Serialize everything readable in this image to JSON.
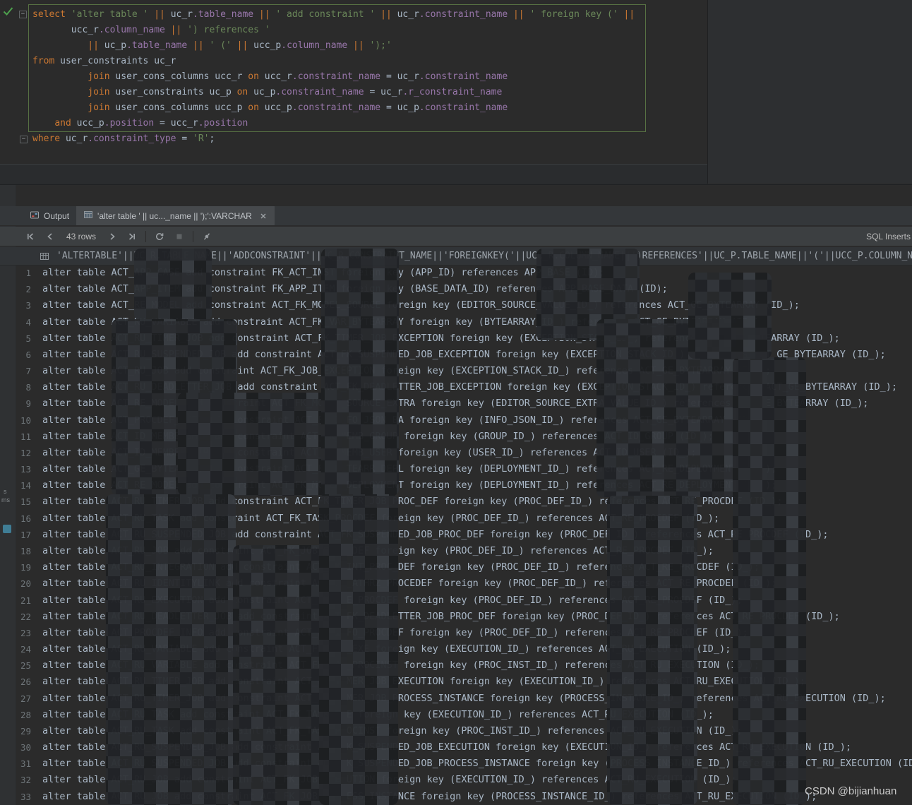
{
  "colors": {
    "editor_bg": "#2b2b2b",
    "panel_bg": "#3c3f41",
    "keyword": "#cc7832",
    "string": "#6a8759",
    "column": "#9876aa",
    "identifier": "#a9b7c6",
    "selection_border": "#577143",
    "run_check_green": "#4da14d",
    "row_number": "#6e7579",
    "result_text": "#a9b7c6"
  },
  "editor": {
    "code_lines": [
      [
        {
          "t": "select ",
          "c": "kw"
        },
        {
          "t": "'alter table ' ",
          "c": "str"
        },
        {
          "t": "|| ",
          "c": "op"
        },
        {
          "t": "uc_r",
          "c": "id"
        },
        {
          "t": ".table_name ",
          "c": "col"
        },
        {
          "t": "|| ",
          "c": "op"
        },
        {
          "t": "' add constraint ' ",
          "c": "str"
        },
        {
          "t": "|| ",
          "c": "op"
        },
        {
          "t": "uc_r",
          "c": "id"
        },
        {
          "t": ".constraint_name ",
          "c": "col"
        },
        {
          "t": "|| ",
          "c": "op"
        },
        {
          "t": "' foreign key (' ",
          "c": "str"
        },
        {
          "t": "||",
          "c": "op"
        }
      ],
      [
        {
          "t": "       ucc_r",
          "c": "id"
        },
        {
          "t": ".column_name ",
          "c": "col"
        },
        {
          "t": "|| ",
          "c": "op"
        },
        {
          "t": "') references '",
          "c": "str"
        }
      ],
      [
        {
          "t": "          ",
          "c": "id"
        },
        {
          "t": "|| ",
          "c": "op"
        },
        {
          "t": "uc_p",
          "c": "id"
        },
        {
          "t": ".table_name ",
          "c": "col"
        },
        {
          "t": "|| ",
          "c": "op"
        },
        {
          "t": "' (' ",
          "c": "str"
        },
        {
          "t": "|| ",
          "c": "op"
        },
        {
          "t": "ucc_p",
          "c": "id"
        },
        {
          "t": ".column_name ",
          "c": "col"
        },
        {
          "t": "|| ",
          "c": "op"
        },
        {
          "t": "');'",
          "c": "str"
        }
      ],
      [
        {
          "t": "from ",
          "c": "kw"
        },
        {
          "t": "user_constraints uc_r",
          "c": "id"
        }
      ],
      [
        {
          "t": "          ",
          "c": "id"
        },
        {
          "t": "join ",
          "c": "kw"
        },
        {
          "t": "user_cons_columns ucc_r ",
          "c": "id"
        },
        {
          "t": "on ",
          "c": "kw"
        },
        {
          "t": "ucc_r",
          "c": "id"
        },
        {
          "t": ".constraint_name ",
          "c": "col"
        },
        {
          "t": "= uc_r",
          "c": "id"
        },
        {
          "t": ".constraint_name",
          "c": "col"
        }
      ],
      [
        {
          "t": "          ",
          "c": "id"
        },
        {
          "t": "join ",
          "c": "kw"
        },
        {
          "t": "user_constraints uc_p ",
          "c": "id"
        },
        {
          "t": "on ",
          "c": "kw"
        },
        {
          "t": "uc_p",
          "c": "id"
        },
        {
          "t": ".constraint_name ",
          "c": "col"
        },
        {
          "t": "= uc_r",
          "c": "id"
        },
        {
          "t": ".r_constraint_name",
          "c": "col"
        }
      ],
      [
        {
          "t": "          ",
          "c": "id"
        },
        {
          "t": "join ",
          "c": "kw"
        },
        {
          "t": "user_cons_columns ucc_p ",
          "c": "id"
        },
        {
          "t": "on ",
          "c": "kw"
        },
        {
          "t": "ucc_p",
          "c": "id"
        },
        {
          "t": ".constraint_name ",
          "c": "col"
        },
        {
          "t": "= uc_p",
          "c": "id"
        },
        {
          "t": ".constraint_name",
          "c": "col"
        }
      ],
      [
        {
          "t": "    ",
          "c": "id"
        },
        {
          "t": "and ",
          "c": "kw"
        },
        {
          "t": "ucc_p",
          "c": "id"
        },
        {
          "t": ".position ",
          "c": "col"
        },
        {
          "t": "= ucc_r",
          "c": "id"
        },
        {
          "t": ".position",
          "c": "col"
        }
      ],
      [
        {
          "t": "where ",
          "c": "kw"
        },
        {
          "t": "uc_r",
          "c": "id"
        },
        {
          "t": ".constraint_type ",
          "c": "col"
        },
        {
          "t": "= ",
          "c": "id"
        },
        {
          "t": "'R'",
          "c": "str"
        },
        {
          "t": ";",
          "c": "id"
        }
      ]
    ]
  },
  "stripe": {
    "label1": "s",
    "label2": "ms"
  },
  "output": {
    "tabs": [
      {
        "label": "Output"
      },
      {
        "label": "'alter table ' || uc..._name || ');':VARCHAR"
      }
    ],
    "toolbar": {
      "rows_label": "43 rows",
      "right_label": "SQL Inserts"
    },
    "grid": {
      "header": "'ALTERTABLE'||UC_R.TABLE_NAME||'ADDCONSTRAINT'||UC_R.CONSTRAINT_NAME||'FOREIGNKEY('||UCC_R.COLUMN_NAME||')REFERENCES'||UC_P.TABLE_NAME||'('||UCC_P.COLUMN_NAME||');'",
      "rows": [
        "alter table ACT_APP_CASE add constraint FK_ACT_INST foreign key (APP_ID) references APP_BASE (ID);",
        "alter table ACT_APP_ITEM add constraint FK_APP_ITEM foreign key (BASE_DATA_ID) references APP_BASE_DATA (ID);",
        "alter table ACT_RE_MODEL add constraint ACT_FK_MODEL_SOURCE foreign key (EDITOR_SOURCE_VALUE_ID_) references ACT_GE_BYTEARRAY (ID_);",
        "alter table ACT_RU_VARIABLE add constraint ACT_FK_VAR_BYTEARRAY foreign key (BYTEARRAY_ID_) references ACT_GE_BYTEARRAY (ID_);",
        "alter table ACT_RU_TIMER_JOB add constraint ACT_FK_TIMER_JOB_EXCEPTION foreign key (EXCEPTION_STACK_ID_) references ACT_GE_BYTEARRAY (ID_);",
        "alter table ACT_RU_SUSPENDED_JOB add constraint ACT_FK_SUSPENDED_JOB_EXCEPTION foreign key (EXCEPTION_STACK_ID_) references ACT_GE_BYTEARRAY (ID_);",
        "alter table ACT_RU_JOB add constraint ACT_FK_JOB_EXCEPTION foreign key (EXCEPTION_STACK_ID_) references ACT_GE_BYTEARRAY (ID_);",
        "alter table ACT_RU_DEADLETTER_JOB add constraint ACT_FK_DEADLETTER_JOB_EXCEPTION foreign key (EXCEPTION_STACK_ID_) references ACT_GE_BYTEARRAY (ID_);",
        "alter table ACT_RE_MODEL add constraint ACT_FK_MODEL_SOURCE_EXTRA foreign key (EDITOR_SOURCE_EXTRA_VALUE_ID_) references ACT_GE_BYTEARRAY (ID_);",
        "alter table ACT_PROCDEF_INFO add constraint ACT_FK_INFO_JSON_BA foreign key (INFO_JSON_ID_) references ACT_GE_BYTEARRAY (ID_);",
        "alter table ACT_ID_MEMBERSHIP add constraint ACT_FK_MEMB_GROUP foreign key (GROUP_ID_) references ACT_ID_GROUP (ID_);",
        "alter table ACT_ID_MEMBERSHIP add constraint ACT_FK_MEMB_USER foreign key (USER_ID_) references ACT_ID_USER (ID_);",
        "alter table ACT_GE_BYTEARRAY add constraint ACT_FK_BYTEARR_DEPL foreign key (DEPLOYMENT_ID_) references ACT_RE_DEPLOYMENT (ID_);",
        "alter table ACT_RE_MODEL add constraint ACT_FK_MODEL_DEPLOYMENT foreign key (DEPLOYMENT_ID_) references ACT_RE_DEPLOYMENT (ID_);",
        "alter table ACT_RU_TIMER_JOB add constraint ACT_FK_TIMER_JOB_PROC_DEF foreign key (PROC_DEF_ID_) references ACT_RE_PROCDEF (ID_);",
        "alter table ACT_RU_TASK add constraint ACT_FK_TASK_PROCDEF foreign key (PROC_DEF_ID_) references ACT_RE_PROCDEF (ID_);",
        "alter table ACT_RU_SUSPENDED_JOB add constraint ACT_FK_SUSPENDED_JOB_PROC_DEF foreign key (PROC_DEF_ID_) references ACT_RE_PROCDEF (ID_);",
        "alter table ACT_RU_JOB add constraint ACT_FK_JOB_PROC_DEF foreign key (PROC_DEF_ID_) references ACT_RE_PROCDEF (ID_);",
        "alter table ACT_RU_INTEGRATION add constraint ACT_FK_INT_PROC_DEF foreign key (PROC_DEF_ID_) references ACT_RE_PROCDEF (ID_);",
        "alter table ACT_RU_IDENTITYLINK add constraint ACT_FK_ATHRZ_PROCEDEF foreign key (PROC_DEF_ID_) references ACT_RE_PROCDEF (ID_);",
        "alter table ACT_RU_EXECUTION add constraint ACT_FK_EXE_PROCDEF foreign key (PROC_DEF_ID_) references ACT_RE_PROCDEF (ID_);",
        "alter table ACT_RU_DEADLETTER_JOB add constraint ACT_FK_DEADLETTER_JOB_PROC_DEF foreign key (PROC_DEF_ID_) references ACT_RE_PROCDEF (ID_);",
        "alter table ACT_PROCDEF_INFO add constraint ACT_FK_INFO_PROCDEF foreign key (PROC_DEF_ID_) references ACT_RE_PROCDEF (ID_);",
        "alter table ACT_RU_VARIABLE add constraint ACT_FK_VAR_EXE foreign key (EXECUTION_ID_) references ACT_RU_EXECUTION (ID_);",
        "alter table ACT_RU_VARIABLE add constraint ACT_FK_VAR_PROCINST foreign key (PROC_INST_ID_) references ACT_RU_EXECUTION (ID_);",
        "alter table ACT_RU_TIMER_JOB add constraint ACT_FK_TIMER_JOB_EXECUTION foreign key (EXECUTION_ID_) references ACT_RU_EXECUTION (ID_);",
        "alter table ACT_RU_TIMER_JOB add constraint ACT_FK_TIMER_JOB_PROCESS_INSTANCE foreign key (PROCESS_INSTANCE_ID_) references ACT_RU_EXECUTION (ID_);",
        "alter table ACT_RU_TASK add constraint ACT_FK_TASK_EXE foreign key (EXECUTION_ID_) references ACT_RU_EXECUTION (ID_);",
        "alter table ACT_RU_TASK add constraint ACT_FK_TASK_PROCINST foreign key (PROC_INST_ID_) references ACT_RU_EXECUTION (ID_);",
        "alter table ACT_RU_SUSPENDED_JOB add constraint ACT_FK_SUSPENDED_JOB_EXECUTION foreign key (EXECUTION_ID_) references ACT_RU_EXECUTION (ID_);",
        "alter table ACT_RU_SUSPENDED_JOB add constraint ACT_FK_SUSPENDED_JOB_PROCESS_INSTANCE foreign key (PROCESS_INSTANCE_ID_) references ACT_RU_EXECUTION (ID_);",
        "alter table ACT_RU_JOB add constraint ACT_FK_JOB_EXECUTION foreign key (EXECUTION_ID_) references ACT_RU_EXECUTION (ID_);",
        "alter table ACT_RU_JOB add constraint ACT_FK_JOB_PROCESS_INSTANCE foreign key (PROCESS_INSTANCE_ID_) references ACT_RU_EXECUTION (ID_);"
      ]
    }
  },
  "watermark": "CSDN @bijianhuan"
}
